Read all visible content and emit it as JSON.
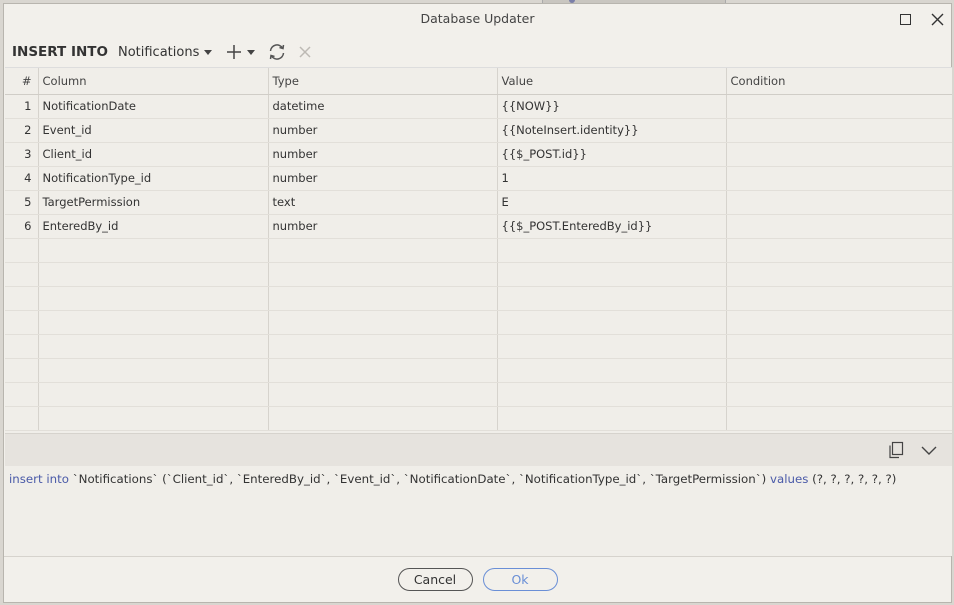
{
  "window": {
    "title": "Database Updater"
  },
  "toolbar": {
    "label": "INSERT INTO",
    "table": "Notifications"
  },
  "grid": {
    "headers": [
      "#",
      "Column",
      "Type",
      "Value",
      "Condition"
    ],
    "rows": [
      {
        "n": "1",
        "column": "NotificationDate",
        "type": "datetime",
        "value": "{{NOW}}",
        "condition": ""
      },
      {
        "n": "2",
        "column": "Event_id",
        "type": "number",
        "value": "{{NoteInsert.identity}}",
        "condition": ""
      },
      {
        "n": "3",
        "column": "Client_id",
        "type": "number",
        "value": "{{$_POST.id}}",
        "condition": ""
      },
      {
        "n": "4",
        "column": "NotificationType_id",
        "type": "number",
        "value": "1",
        "condition": ""
      },
      {
        "n": "5",
        "column": "TargetPermission",
        "type": "text",
        "value": "E",
        "condition": ""
      },
      {
        "n": "6",
        "column": "EnteredBy_id",
        "type": "number",
        "value": "{{$_POST.EnteredBy_id}}",
        "condition": ""
      }
    ],
    "empty_rows": 8
  },
  "sql": {
    "kw_insert": "insert into",
    "body": " `Notifications` (`Client_id`, `EnteredBy_id`, `Event_id`, `NotificationDate`, `NotificationType_id`, `TargetPermission`) ",
    "kw_values": "values",
    "tail": " (?, ?, ?, ?, ?, ?)"
  },
  "footer": {
    "cancel_label": "Cancel",
    "ok_label": "Ok"
  },
  "colors": {
    "accent": "#6a8fd6",
    "keyword": "#4a5aa8"
  },
  "icons": [
    "maximize-icon",
    "close-icon",
    "plus-icon",
    "refresh-icon",
    "delete-icon",
    "copy-icon",
    "chevron-down-icon"
  ]
}
